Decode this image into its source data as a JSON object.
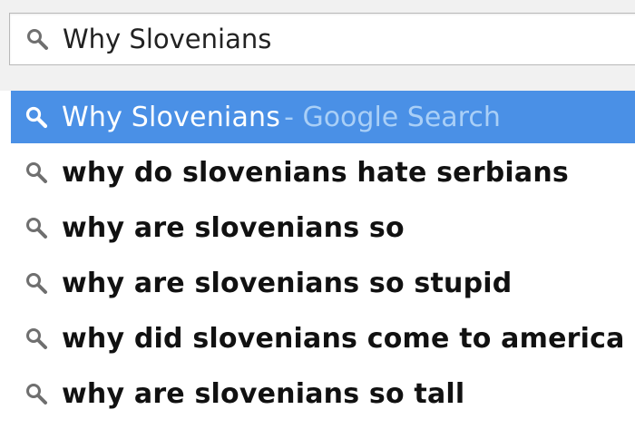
{
  "omnibox": {
    "icon": "search-icon",
    "value": "Why Slovenians"
  },
  "dropdown": {
    "selected": {
      "icon": "search-icon",
      "text": "Why Slovenians",
      "suffix": "- Google Search"
    },
    "suggestions": [
      {
        "icon": "search-icon",
        "text": "why do slovenians hate serbians"
      },
      {
        "icon": "search-icon",
        "text": "why are slovenians so"
      },
      {
        "icon": "search-icon",
        "text": "why are slovenians so stupid"
      },
      {
        "icon": "search-icon",
        "text": "why did slovenians come to america"
      },
      {
        "icon": "search-icon",
        "text": "why are slovenians so tall"
      }
    ]
  },
  "colors": {
    "highlight": "#4a90e6",
    "suffix": "#a9cff7",
    "icon": "#6f6f6f"
  }
}
